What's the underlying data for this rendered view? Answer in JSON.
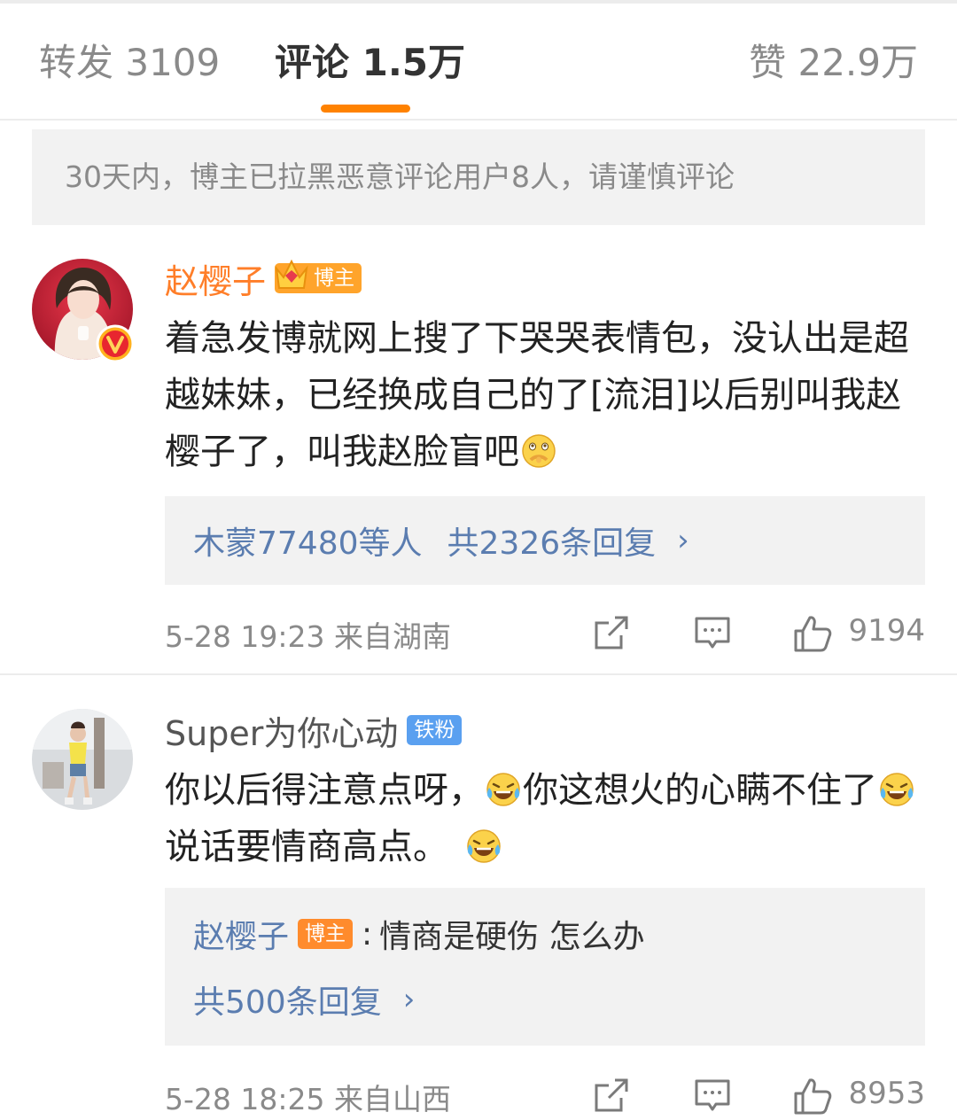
{
  "tabs": {
    "repost": "转发 3109",
    "comments": "评论 1.5万",
    "likes": "赞 22.9万"
  },
  "notice": "30天内，博主已拉黑恶意评论用户8人，请谨慎评论",
  "colors": {
    "accent": "#ff8200",
    "link": "#5b7db0",
    "host_badge": "#ffa42b",
    "fan_badge": "#5aa0f0"
  },
  "comments": [
    {
      "username": "赵樱子",
      "badge": "博主",
      "text": "着急发博就网上搜了下哭哭表情包，没认出是超越妹妹，已经换成自己的了[流泪]以后别叫我赵樱子了，叫我赵脸盲吧",
      "emoji": "think-face-icon",
      "reply_users": "木蒙77480等人",
      "reply_count": "共2326条回复",
      "timestamp": "5-28 19:23  来自湖南",
      "likes": "9194"
    },
    {
      "username": "Super为你心动",
      "badge": "铁粉",
      "text_parts": [
        "你以后得注意点呀，",
        "你这想火的心瞒不住了",
        "说话要情商高点。"
      ],
      "emoji": "laugh-cry-icon",
      "reply_author": "赵樱子",
      "reply_badge": "博主",
      "reply_text": "情商是硬伤  怎么办",
      "reply_count": "共500条回复",
      "timestamp": "5-28 18:25  来自山西",
      "likes": "8953"
    }
  ]
}
